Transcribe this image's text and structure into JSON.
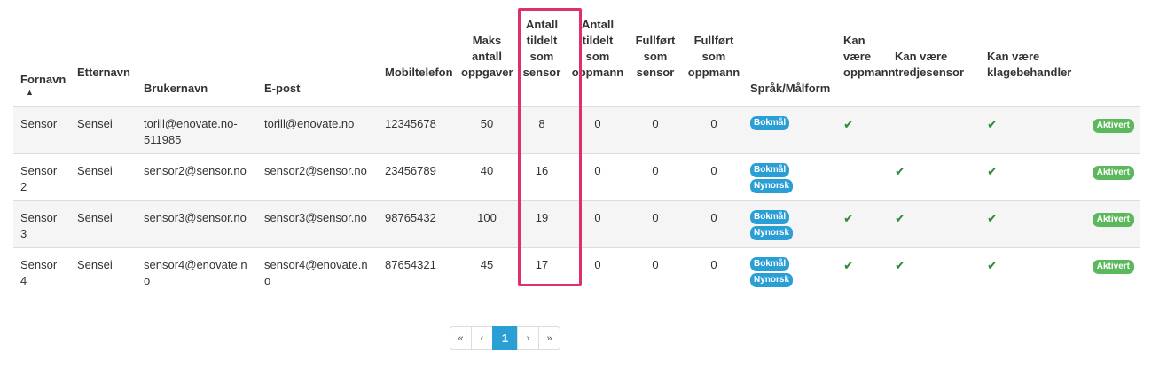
{
  "columns": {
    "fornavn": "Fornavn",
    "sort_indicator": "▲",
    "etternavn": "Etternavn",
    "brukernavn": "Brukernavn",
    "epost": "E-post",
    "mobil": "Mobiltelefon",
    "maks": "Maks antall oppgaver",
    "sensor_count": "Antall tildelt som sensor",
    "oppmann_count": "Antall tildelt som oppmann",
    "fullfort_sensor": "Fullført som sensor",
    "fullfort_oppmann": "Fullført som oppmann",
    "sprak": "Språk/Målform",
    "kan_oppmann": "Kan være oppmann",
    "kan_tredje": "Kan være tredjesensor",
    "kan_klage": "Kan være klagebehandler"
  },
  "rows": [
    {
      "fornavn": "Sensor",
      "etternavn": "Sensei",
      "brukernavn": "torill@enovate.no-511985",
      "epost": "torill@enovate.no",
      "mobil": "12345678",
      "maks": "50",
      "sensor_count": "8",
      "oppmann_count": "0",
      "fullfort_sensor": "0",
      "fullfort_oppmann": "0",
      "lang1": "Bokmål",
      "lang2": "",
      "kan_oppmann": "✔",
      "kan_tredje": "",
      "kan_klage": "✔",
      "status": "Aktivert"
    },
    {
      "fornavn": "Sensor 2",
      "etternavn": "Sensei",
      "brukernavn": "sensor2@sensor.no",
      "epost": "sensor2@sensor.no",
      "mobil": "23456789",
      "maks": "40",
      "sensor_count": "16",
      "oppmann_count": "0",
      "fullfort_sensor": "0",
      "fullfort_oppmann": "0",
      "lang1": "Bokmål",
      "lang2": "Nynorsk",
      "kan_oppmann": "",
      "kan_tredje": "✔",
      "kan_klage": "✔",
      "status": "Aktivert"
    },
    {
      "fornavn": "Sensor 3",
      "etternavn": "Sensei",
      "brukernavn": "sensor3@sensor.no",
      "epost": "sensor3@sensor.no",
      "mobil": "98765432",
      "maks": "100",
      "sensor_count": "19",
      "oppmann_count": "0",
      "fullfort_sensor": "0",
      "fullfort_oppmann": "0",
      "lang1": "Bokmål",
      "lang2": "Nynorsk",
      "kan_oppmann": "✔",
      "kan_tredje": "✔",
      "kan_klage": "✔",
      "status": "Aktivert"
    },
    {
      "fornavn": "Sensor 4",
      "etternavn": "Sensei",
      "brukernavn": "sensor4@enovate.no",
      "epost": "sensor4@enovate.no",
      "mobil": "87654321",
      "maks": "45",
      "sensor_count": "17",
      "oppmann_count": "0",
      "fullfort_sensor": "0",
      "fullfort_oppmann": "0",
      "lang1": "Bokmål",
      "lang2": "Nynorsk",
      "kan_oppmann": "✔",
      "kan_tredje": "✔",
      "kan_klage": "✔",
      "status": "Aktivert"
    }
  ],
  "pagination": {
    "first": "«",
    "prev": "‹",
    "current": "1",
    "next": "›",
    "last": "»"
  },
  "colors": {
    "accent": "#2a9fd6",
    "success": "#5cb85c",
    "check": "#2e8b3b",
    "highlight": "#e0306a"
  }
}
